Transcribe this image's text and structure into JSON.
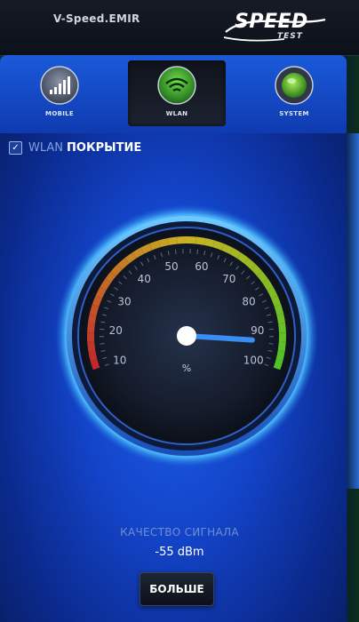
{
  "header": {
    "app_title": "V-Speed.EMIR",
    "logo_word": "SPEED",
    "logo_sub": "TEST"
  },
  "tabs": [
    {
      "label": "MOBILE",
      "icon": "signal-bars-icon",
      "active": false
    },
    {
      "label": "WLAN",
      "icon": "wifi-icon",
      "active": true
    },
    {
      "label": "SYSTEM",
      "icon": "system-orb-icon",
      "active": false
    }
  ],
  "section": {
    "check_mark": "✓",
    "title_prefix": "WLAN",
    "title_main": "ПОКРЫТИЕ"
  },
  "gauge": {
    "ticks": [
      "10",
      "20",
      "30",
      "40",
      "50",
      "60",
      "70",
      "80",
      "90",
      "100"
    ],
    "unit": "%",
    "value_percent": 90
  },
  "signal": {
    "label": "КАЧЕСТВО СИГНАЛА",
    "value": "-55 dBm"
  },
  "more_button": "БОЛЬШЕ",
  "colors": {
    "accent_blue": "#1b5fe8",
    "gauge_red": "#c0242b",
    "gauge_yellow": "#c9b323",
    "gauge_green": "#4cc227",
    "needle": "#3a8df5"
  }
}
